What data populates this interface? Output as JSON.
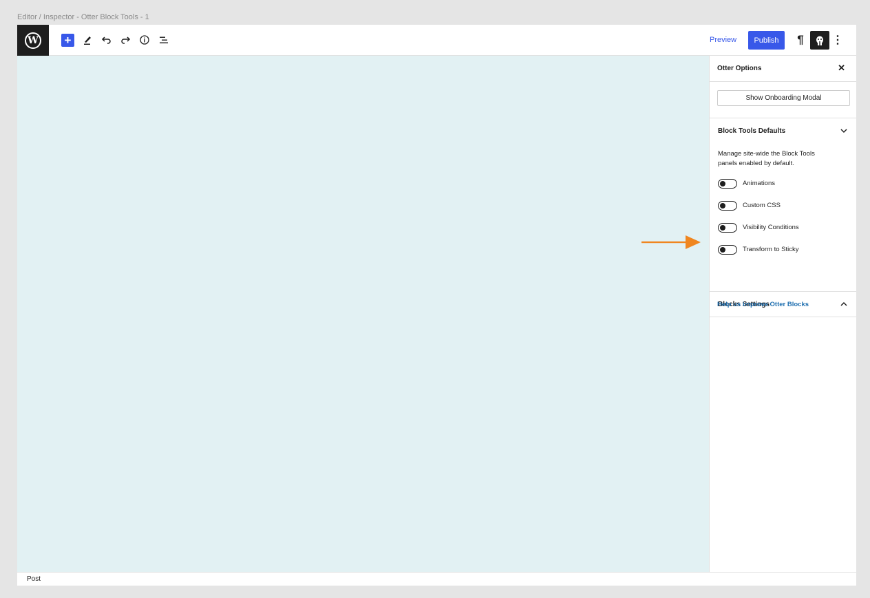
{
  "frame": {
    "caption": "Editor / Inspector - Otter Block Tools - 1"
  },
  "toolbar": {
    "logo_icon": "wordpress-logo-icon",
    "logo_text": "W",
    "add_label": "+",
    "tools": [
      "pencil-icon",
      "undo-icon",
      "redo-icon",
      "info-icon",
      "list-view-icon"
    ],
    "preview_label": "Preview",
    "publish_label": "Publish",
    "paragraph_symbol": "¶",
    "more_symbol": "⋮",
    "accent_color": "#3858e9"
  },
  "canvas": {
    "background": "#e2f1f3",
    "annotation_arrow_color": "#f0861f"
  },
  "sidebar": {
    "title": "Otter Options",
    "close_symbol": "✕",
    "onboarding_button": "Show Onboarding Modal",
    "block_tools_panel": {
      "title": "Block Tools Defaults",
      "expanded": true,
      "description": "Manage site-wide the Block Tools panels enabled by default.",
      "toggles": [
        {
          "label": "Animations",
          "enabled": false
        },
        {
          "label": "Custom CSS",
          "enabled": false
        },
        {
          "label": "Visibility Conditions",
          "enabled": false
        },
        {
          "label": "Transform to Sticky",
          "enabled": false
        }
      ]
    },
    "blocks_settings_panel": {
      "title": "Blocks Settings",
      "expanded": false
    },
    "help_link": "Help us improve Otter Blocks"
  },
  "footer": {
    "breadcrumb": "Post"
  }
}
